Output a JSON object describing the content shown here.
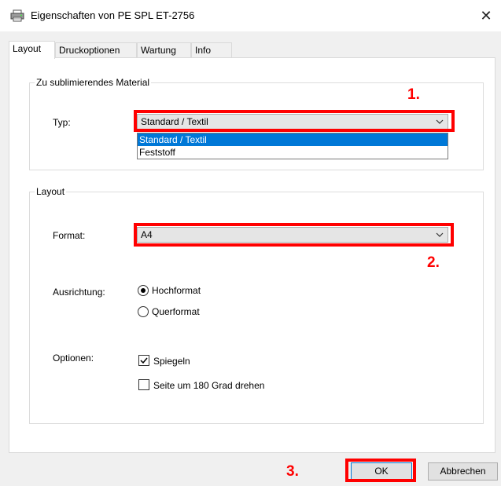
{
  "window": {
    "title": "Eigenschaften von PE SPL ET-2756",
    "close_glyph": "✕",
    "title_icon": "printer-icon"
  },
  "tabs": [
    {
      "label": "Layout",
      "active": true
    },
    {
      "label": "Druckoptionen",
      "active": false
    },
    {
      "label": "Wartung",
      "active": false
    },
    {
      "label": "Info",
      "active": false
    }
  ],
  "material_group": {
    "title": "Zu sublimierendes Material",
    "type_label": "Typ:",
    "type_value": "Standard / Textil",
    "type_options": [
      "Standard / Textil",
      "Feststoff"
    ]
  },
  "layout_group": {
    "title": "Layout",
    "format_label": "Format:",
    "format_value": "A4",
    "orientation_label": "Ausrichtung:",
    "orientation_options": [
      {
        "label": "Hochformat",
        "selected": true
      },
      {
        "label": "Querformat",
        "selected": false
      }
    ],
    "options_label": "Optionen:",
    "checkboxes": [
      {
        "label": "Spiegeln",
        "checked": true
      },
      {
        "label": "Seite um 180 Grad drehen",
        "checked": false
      }
    ]
  },
  "buttons": {
    "ok": "OK",
    "cancel": "Abbrechen"
  },
  "annotations": {
    "step1": "1.",
    "step2": "2.",
    "step3": "3.",
    "highlight_color": "#ff0000"
  },
  "colors": {
    "selection": "#0078d7",
    "panel_bg": "#ffffff",
    "dialog_bg": "#f0f0f0"
  }
}
